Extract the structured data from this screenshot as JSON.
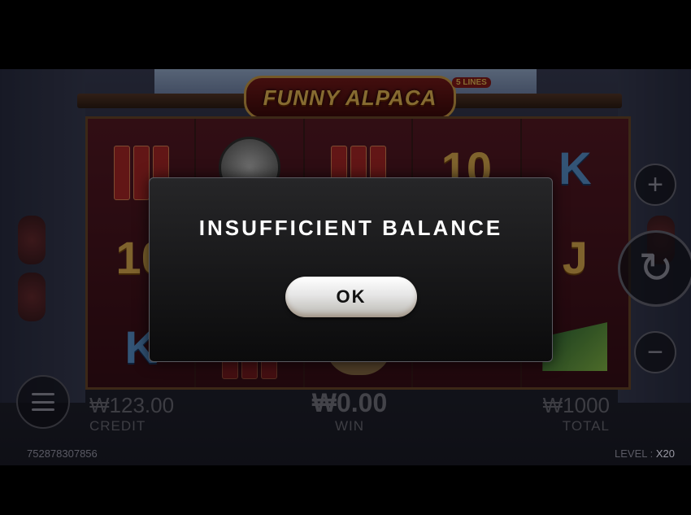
{
  "game": {
    "title": "FUNNY ALPACA",
    "lines_badge": "5 LINES"
  },
  "reels": [
    {
      "symbols": [
        {
          "icon": "firecracker-icon"
        },
        {
          "text": "10"
        },
        {
          "text": "K"
        }
      ]
    },
    {
      "symbols": [
        {
          "icon": "gong-icon"
        },
        {
          "text": ""
        },
        {
          "icon": "firecracker-icon"
        }
      ]
    },
    {
      "symbols": [
        {
          "icon": "firecracker-icon"
        },
        {
          "text": ""
        },
        {
          "icon": "alpaca-icon"
        }
      ]
    },
    {
      "symbols": [
        {
          "text": "10"
        },
        {
          "text": ""
        },
        {
          "text": ""
        }
      ]
    },
    {
      "symbols": [
        {
          "text": "K"
        },
        {
          "text": "J"
        },
        {
          "icon": "fan-icon"
        }
      ]
    }
  ],
  "hud": {
    "credit_value": "₩123.00",
    "credit_label": "CREDIT",
    "win_value": "₩0.00",
    "win_label": "WIN",
    "total_value": "₩1000",
    "total_label": "TOTAL",
    "player_id": "752878307856",
    "level_label": "LEVEL :",
    "level_value": "X20"
  },
  "controls": {
    "plus_symbol": "+",
    "minus_symbol": "−",
    "spin_symbol": "↻"
  },
  "dialog": {
    "message": "INSUFFICIENT BALANCE",
    "ok_label": "OK"
  }
}
